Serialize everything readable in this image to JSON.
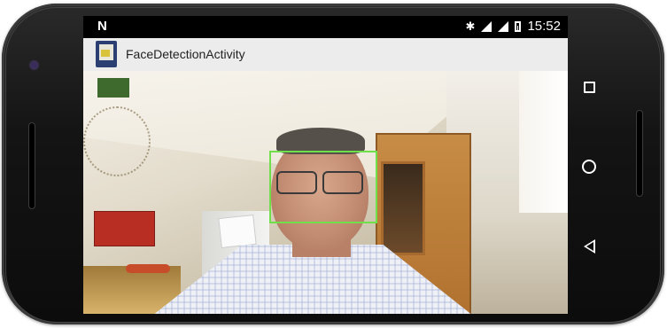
{
  "statusbar": {
    "notification_glyph": "N",
    "time": "15:52",
    "icons": [
      "bluetooth-icon",
      "signal-icon",
      "signal-icon",
      "battery-icon"
    ]
  },
  "appbar": {
    "title": "FaceDetectionActivity",
    "icon": "app-icon"
  },
  "camera": {
    "detected_faces": 1,
    "box_color": "#6fe04a"
  },
  "navbar": {
    "buttons": [
      "recents-icon",
      "home-icon",
      "back-icon"
    ]
  }
}
